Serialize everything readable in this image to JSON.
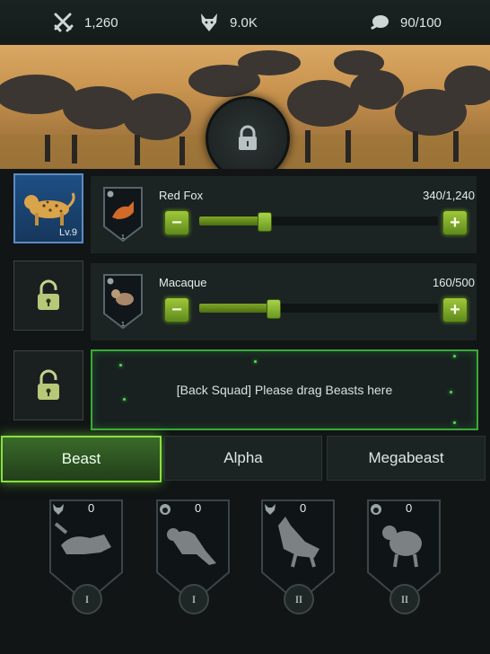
{
  "resources": [
    {
      "icon": "crossed-swords-icon",
      "value": "1,260"
    },
    {
      "icon": "wolf-head-icon",
      "value": "9.0K"
    },
    {
      "icon": "meat-icon",
      "value": "90/100"
    }
  ],
  "banner": {
    "lock_icon": "lock-icon"
  },
  "squad": {
    "rows": [
      {
        "slot_level": "Lv.9",
        "name": "Red Fox",
        "count": "340/1,240",
        "progress": 0.27
      },
      {
        "name": "Macaque",
        "count": "160/500",
        "progress": 0.31
      }
    ],
    "mini_badge": "1",
    "back_squad_text": "[Back Squad] Please drag Beasts here",
    "minus_label": "−",
    "plus_label": "+"
  },
  "tabs": [
    {
      "label": "Beast",
      "active": true
    },
    {
      "label": "Alpha",
      "active": false
    },
    {
      "label": "Megabeast",
      "active": false
    }
  ],
  "beast_cards": [
    {
      "icon": "wolf-head-icon",
      "count": "0",
      "tier": "I"
    },
    {
      "icon": "monkey-head-icon",
      "count": "0",
      "tier": "I"
    },
    {
      "icon": "wolf-head-icon",
      "count": "0",
      "tier": "II"
    },
    {
      "icon": "monkey-head-icon",
      "count": "0",
      "tier": "II"
    }
  ],
  "colors": {
    "accent_green": "#8ae040",
    "slot_blue": "#1e4f84"
  }
}
